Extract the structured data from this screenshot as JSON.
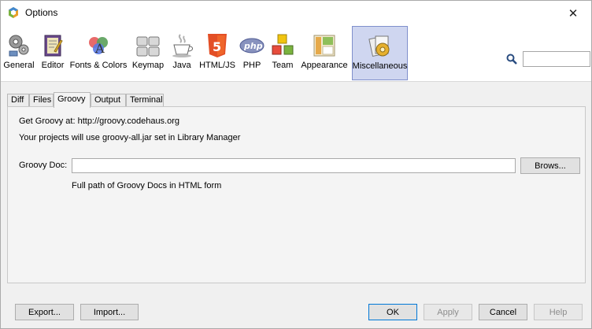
{
  "window": {
    "title": "Options",
    "close_glyph": "✕"
  },
  "categories": [
    {
      "id": "general",
      "label": "General",
      "icon": "gears-icon"
    },
    {
      "id": "editor",
      "label": "Editor",
      "icon": "editor-icon"
    },
    {
      "id": "fonts",
      "label": "Fonts & Colors",
      "icon": "fonts-colors-icon"
    },
    {
      "id": "keymap",
      "label": "Keymap",
      "icon": "keymap-icon"
    },
    {
      "id": "java",
      "label": "Java",
      "icon": "java-cup-icon"
    },
    {
      "id": "html",
      "label": "HTML/JS",
      "icon": "html5-icon"
    },
    {
      "id": "php",
      "label": "PHP",
      "icon": "php-icon"
    },
    {
      "id": "team",
      "label": "Team",
      "icon": "team-cubes-icon"
    },
    {
      "id": "appearance",
      "label": "Appearance",
      "icon": "appearance-icon"
    },
    {
      "id": "misc",
      "label": "Miscellaneous",
      "icon": "miscellaneous-icon",
      "selected": true
    }
  ],
  "search": {
    "value": "",
    "placeholder": ""
  },
  "tabs": [
    {
      "label": "Diff"
    },
    {
      "label": "Files"
    },
    {
      "label": "Groovy",
      "active": true
    },
    {
      "label": "Output"
    },
    {
      "label": "Terminal"
    }
  ],
  "groovy": {
    "get_groovy": "Get Groovy at: http://groovy.codehaus.org",
    "projects_note": "Your projects will use groovy-all.jar set in Library Manager",
    "doc_label": "Groovy Doc:",
    "doc_value": "",
    "browse_label": "Brows...",
    "hint": "Full path of Groovy Docs in HTML form"
  },
  "footer": {
    "export": "Export...",
    "import": "Import...",
    "ok": "OK",
    "apply": "Apply",
    "cancel": "Cancel",
    "help": "Help"
  },
  "colors": {
    "selected_bg": "#cfd6f0",
    "selected_border": "#7f8fcc",
    "primary_border": "#0078d7"
  }
}
